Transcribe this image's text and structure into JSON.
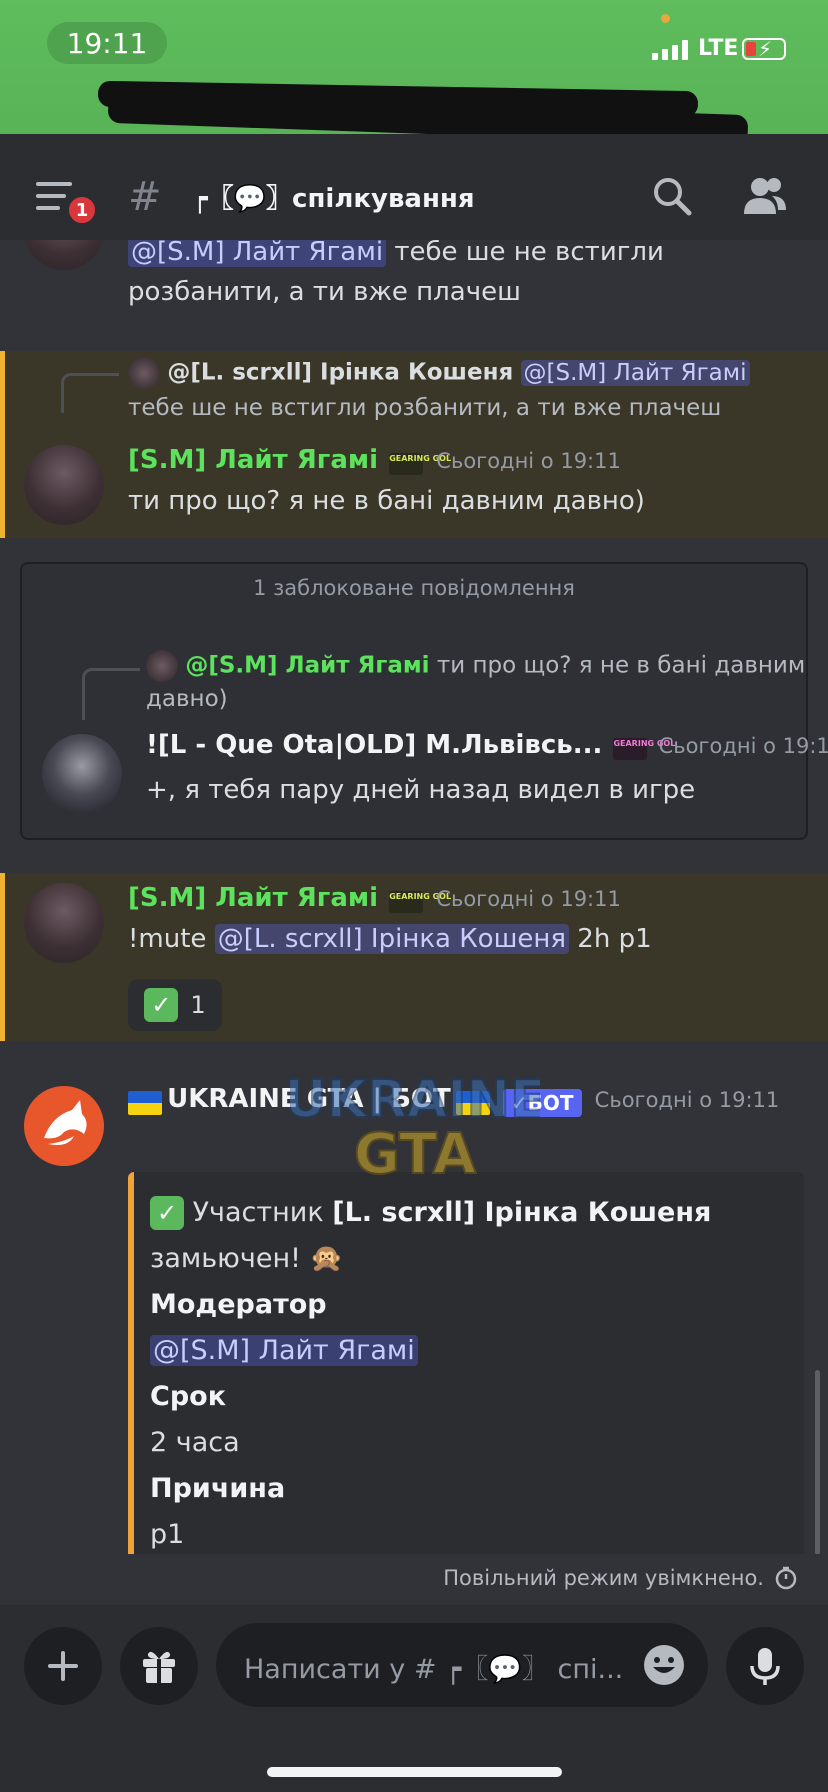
{
  "status_bar": {
    "time": "19:11",
    "network": "LTE"
  },
  "header": {
    "notification_count": "1",
    "hash": "#",
    "channel_name": "┍〖💬〗спілкування"
  },
  "messages": {
    "partial": {
      "mention": "@[S.M] Лайт Ягамі",
      "text1": "тебе ше не встигли",
      "text2": "розбанити, а ти вже плачеш"
    },
    "reply1": {
      "reply_author": "@[L. scrxll] Ірінка Кошеня",
      "reply_mention": "@[S.M] Лайт Ягамі",
      "reply_text": "тебе ше не встигли розбанити, а ти вже плачеш",
      "author": "[S.M] Лайт Ягамі",
      "timestamp": "Сьогодні о 19:11",
      "text": "ти про що? я не в бані давним давно)"
    },
    "blocked": {
      "title": "1 заблоковане повідомлення",
      "reply_author": "@[S.M] Лайт Ягамі",
      "reply_text1": "ти про що? я не в бані давним",
      "reply_text2": "давно)",
      "author": "![L - Que Ota|OLD] М.Львівсь...",
      "timestamp": "Сьогодні о 19:1",
      "text": "+, я тебя пару дней назад видел в игре"
    },
    "mute_cmd": {
      "author": "[S.M] Лайт Ягамі",
      "timestamp": "Сьогодні о 19:11",
      "command": "!mute",
      "mention": "@[L. scrxll] Ірінка Кошеня",
      "args": "2h p1",
      "reaction_emoji": "✓",
      "reaction_count": "1"
    },
    "bot": {
      "author": "UKRAINE GTA | БОТ",
      "bot_tag": "✓БОТ",
      "timestamp": "Сьогодні о 19:11",
      "embed": {
        "line1_prefix": "Участник",
        "line1_name": "[L. scrxll] Ірінка Кошеня",
        "line2": "замьючен! 🙊",
        "moderator_label": "Модератор",
        "moderator": "@[S.M] Лайт Ягамі",
        "term_label": "Срок",
        "term": "2 часа",
        "reason_label": "Причина",
        "reason": "p1"
      }
    }
  },
  "role_tags": {
    "green": "GEARING GOL",
    "pink": "GEARING GOL"
  },
  "watermark": {
    "line1": "UKRAINE",
    "line2": "GTA"
  },
  "slowmode": {
    "text": "Повільний режим увімкнено."
  },
  "composer": {
    "placeholder": "Написати у # ┍〖💬〗 спі..."
  },
  "colors": {
    "background": "#313338",
    "status_green": "#5fbd5d",
    "highlight_border": "#f0b232",
    "username_green": "#5ce25c",
    "mention_bg": "#5865f2",
    "embed_border": "#f0a33a"
  }
}
